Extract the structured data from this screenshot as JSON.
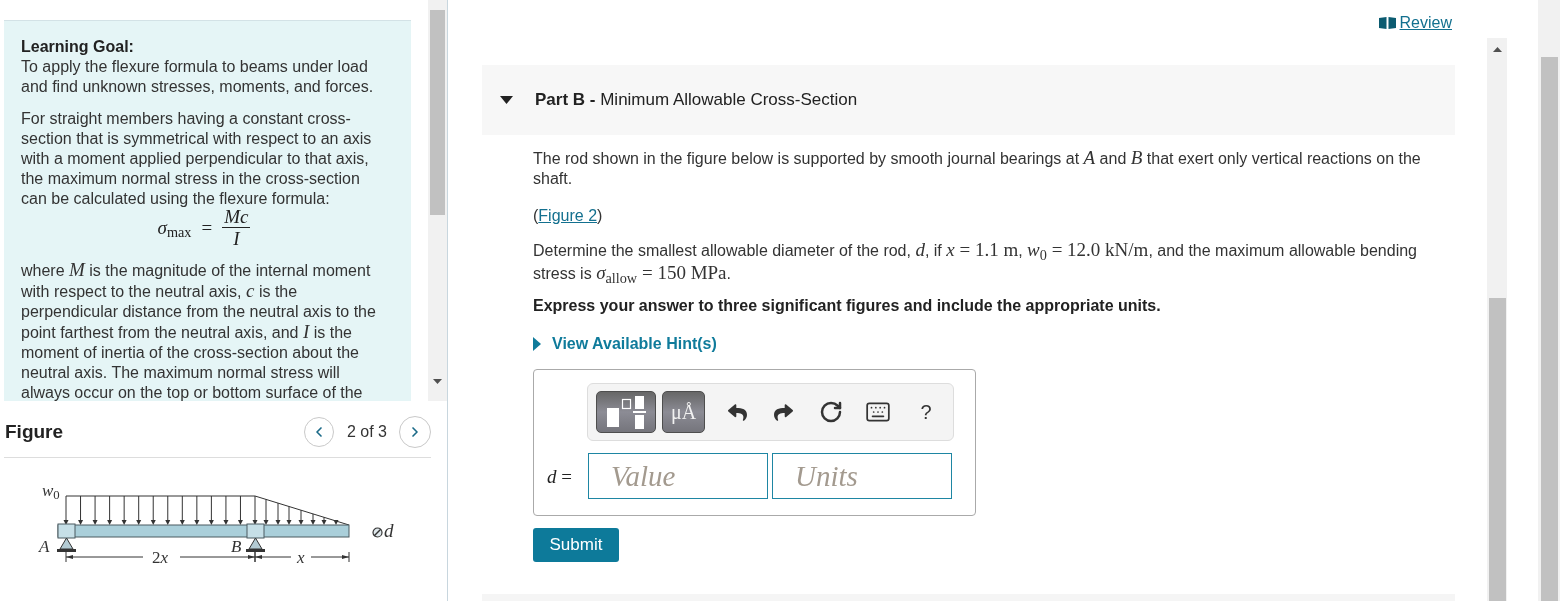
{
  "review_link": {
    "label": "Review"
  },
  "learning_goal": {
    "heading": "Learning Goal:",
    "goal": "To apply the flexure formula to beams under load and find unknown stresses, moments, and forces.",
    "intro": "For straight members having a constant cross-section that is symmetrical with respect to an axis with a moment applied perpendicular to that axis, the maximum normal stress in the cross-section can be calculated using the flexure formula:",
    "formula": {
      "left": "*σ*$_{max}$",
      "relation": "=",
      "numerator": "Mc",
      "denominator": "I"
    },
    "explanation": [
      {
        "kind": "text",
        "text": "where "
      },
      {
        "kind": "variable",
        "text": "M"
      },
      {
        "kind": "text",
        "text": " is the magnitude of the internal moment with respect to the neutral axis, "
      },
      {
        "kind": "variable",
        "text": "c"
      },
      {
        "kind": "text",
        "text": " is the perpendicular distance from the neutral axis to the point farthest from the neutral axis, and "
      },
      {
        "kind": "variable",
        "text": "I"
      },
      {
        "kind": "text",
        "text": " is the moment of inertia of the cross-section about the neutral axis. The maximum normal stress will always occur on the top or bottom surface of the"
      }
    ]
  },
  "figure_panel": {
    "title": "Figure",
    "pager": "2 of 3",
    "diagram": {
      "load": "*w*$_{0}$",
      "support_left": "A",
      "support_right": "B",
      "span_left": [
        {
          "kind": "math",
          "text": "2"
        },
        {
          "kind": "variable",
          "text": "x"
        }
      ],
      "span_right": "x",
      "diameter": "d"
    }
  },
  "part": {
    "title": "**Part B -** Minimum Allowable Cross-Section",
    "expanded": true
  },
  "problem": [
    {
      "kind": "text",
      "text": "The rod shown in the figure below is supported by smooth journal bearings at "
    },
    {
      "kind": "variable",
      "text": "A"
    },
    {
      "kind": "text",
      "text": " and "
    },
    {
      "kind": "variable",
      "text": "B"
    },
    {
      "kind": "text",
      "text": " that exert only vertical reactions on the shaft."
    }
  ],
  "figure_reference": {
    "before": "(",
    "link": "Figure 2",
    "after": ")"
  },
  "question": [
    {
      "kind": "text",
      "text": "Determine the smallest allowable diameter of the rod, "
    },
    {
      "kind": "variable",
      "text": "d"
    },
    {
      "kind": "text",
      "text": ", if "
    },
    {
      "kind": "math",
      "text": "*x* = 1.1 m"
    },
    {
      "kind": "text",
      "text": ", "
    },
    {
      "kind": "math",
      "text": "*w*$_{0}$ = 12.0 kN/m"
    },
    {
      "kind": "text",
      "text": ", and the maximum allowable bending stress is "
    },
    {
      "kind": "math",
      "text": "*σ*$_{allow}$ = 150 MPa"
    },
    {
      "kind": "text",
      "text": "."
    }
  ],
  "instruction": "Express your answer to three significant figures and include the appropriate units.",
  "hints": {
    "label": "View Available Hint(s)",
    "expanded": false
  },
  "answer": {
    "toolbar": [
      {
        "kind": "templates"
      },
      {
        "kind": "symbols",
        "label": "μÅ"
      },
      {
        "kind": "undo"
      },
      {
        "kind": "redo"
      },
      {
        "kind": "reset"
      },
      {
        "kind": "keyboard"
      },
      {
        "kind": "help",
        "label": "?"
      }
    ],
    "variable": "*d* =",
    "value_placeholder": "Value",
    "units_placeholder": "Units"
  },
  "submit": {
    "label": "Submit"
  }
}
